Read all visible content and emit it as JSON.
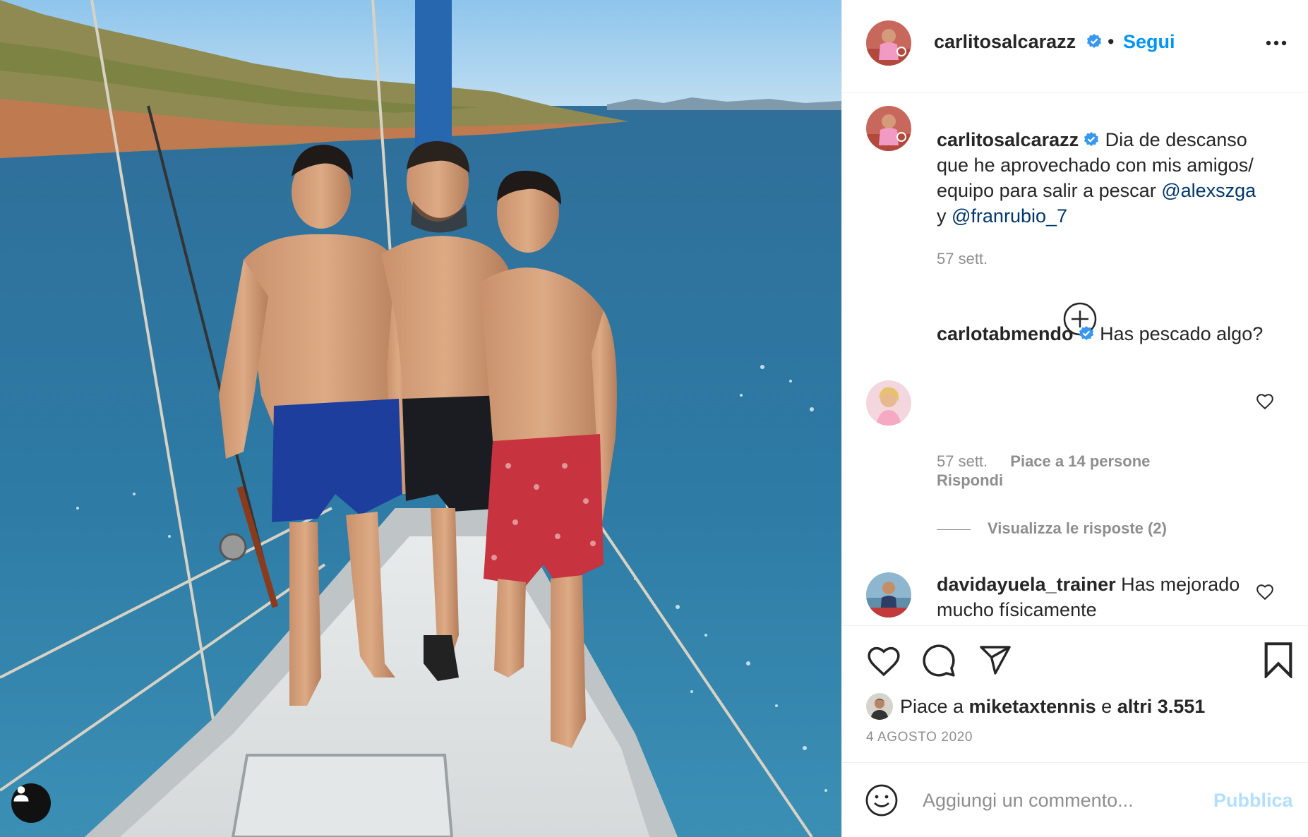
{
  "header": {
    "username": "carlitosalcarazz",
    "separator": "•",
    "follow_label": "Segui",
    "more_icon": "more-horizontal-icon"
  },
  "caption": {
    "username": "carlitosalcarazz",
    "text": "Dia de descanso que he aprovechado con mis amigos/ equipo para salir a pescar",
    "mention_1": "@alexszga",
    "joiner": "y",
    "mention_2": "@franrubio_7",
    "time": "57 sett."
  },
  "comments": [
    {
      "username": "carlotabmendo",
      "verified": true,
      "text": "Has pescado algo?",
      "time": "57 sett.",
      "likes": "Piace a 14 persone",
      "reply_label": "Rispondi",
      "view_replies": "Visualizza le risposte (2)"
    },
    {
      "username": "davidayuela_trainer",
      "verified": false,
      "text": "Has mejorado mucho físicamente"
    }
  ],
  "likes": {
    "prefix": "Piace a",
    "user": "miketaxtennis",
    "joiner": "e",
    "others": "altri 3.551"
  },
  "date": "4 AGOSTO 2020",
  "composer": {
    "placeholder": "Aggiungi un commento...",
    "publish_label": "Pubblica"
  },
  "colors": {
    "link_blue": "#0095f6",
    "mention_blue": "#00376b",
    "muted_gray": "#8e8e8e",
    "publish_disabled": "#b2dffc",
    "verified_blue": "#3897f0"
  }
}
